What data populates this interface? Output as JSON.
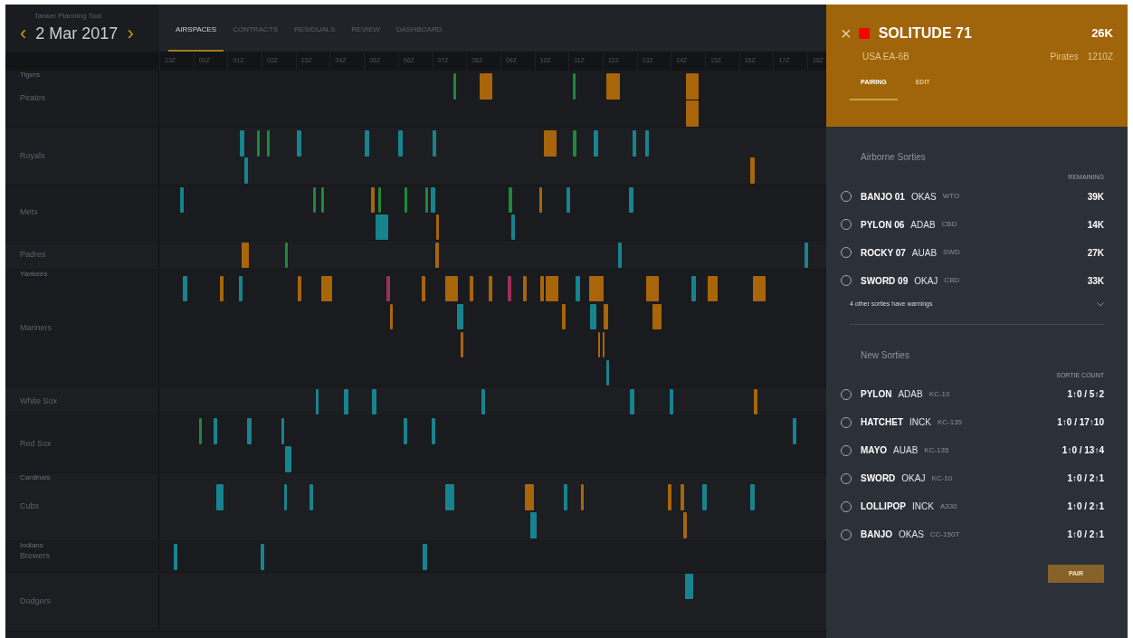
{
  "app": {
    "title": "Tanker Planning Tool",
    "date": "2 Mar 2017",
    "prev": "‹",
    "next": "›"
  },
  "tabs": [
    {
      "label": "AIRSPACES",
      "selected": true
    },
    {
      "label": "CONTRACTS",
      "selected": false
    },
    {
      "label": "RESIDUALS",
      "selected": false
    },
    {
      "label": "REVIEW",
      "selected": false
    },
    {
      "label": "DASHBOARD",
      "selected": false
    }
  ],
  "hours": [
    "23Z",
    "00Z",
    "01Z",
    "02Z",
    "03Z",
    "04Z",
    "05Z",
    "06Z",
    "07Z",
    "08Z",
    "09Z",
    "10Z",
    "11Z",
    "12Z",
    "13Z",
    "14Z",
    "15Z",
    "16Z",
    "17Z",
    "18Z"
  ],
  "rows": [
    {
      "label": "Pirates",
      "sublabel": "Tigers"
    },
    {
      "label": "Royals"
    },
    {
      "label": "Mets"
    },
    {
      "label": "Padres"
    },
    {
      "label": "Mariners",
      "sublabel": "Yankees"
    },
    {
      "label": "White Sox"
    },
    {
      "label": "Red Sox"
    },
    {
      "label": "Cubs",
      "sublabel": "Cardinals"
    },
    {
      "label": "Brewers",
      "sublabel": "Indians"
    },
    {
      "label": "Dodgers"
    }
  ],
  "panel": {
    "close": "×",
    "title": "SOLITUDE 71",
    "amount": "26K",
    "aircraft": "USA EA-6B",
    "airspace": "Pirates",
    "time": "1210Z",
    "tabs": [
      {
        "label": "PAIRING",
        "selected": true
      },
      {
        "label": "EDIT",
        "selected": false
      }
    ],
    "airborne": {
      "heading": "Airborne Sorties",
      "column": "REMAINING",
      "items": [
        {
          "name": "BANJO 01",
          "base": "OKAS",
          "type": "WTO",
          "value": "39K",
          "selected": false
        },
        {
          "name": "PYLON 06",
          "base": "ADAB",
          "type": "CBD",
          "value": "14K",
          "selected": false
        },
        {
          "name": "ROCKY 07",
          "base": "AUAB",
          "type": "SWD",
          "value": "27K",
          "selected": false
        },
        {
          "name": "SWORD 09",
          "base": "OKAJ",
          "type": "CBD",
          "value": "33K",
          "selected": false
        }
      ],
      "warning": "4 other sorties have warnings"
    },
    "new": {
      "heading": "New Sorties",
      "column": "SORTIE COUNT",
      "items": [
        {
          "name": "PYLON",
          "base": "ADAB",
          "type": "KC-10",
          "value": "1↑0 / 5↑2",
          "selected": false
        },
        {
          "name": "HATCHET",
          "base": "INCK",
          "type": "KC-135",
          "value": "1↑0 / 17↑10",
          "selected": false
        },
        {
          "name": "MAYO",
          "base": "AUAB",
          "type": "KC-135",
          "value": "1↑0 / 13↑4",
          "selected": false
        },
        {
          "name": "SWORD",
          "base": "OKAJ",
          "type": "KC-10",
          "value": "1↑0 / 2↑1",
          "selected": false
        },
        {
          "name": "LOLLIPOP",
          "base": "INCK",
          "type": "A330",
          "value": "1↑0 / 2↑1",
          "selected": false
        },
        {
          "name": "BANJO",
          "base": "OKAS",
          "type": "CC-150T",
          "value": "1↑0 / 2↑1",
          "selected": false
        }
      ]
    },
    "button": "PAIR"
  }
}
